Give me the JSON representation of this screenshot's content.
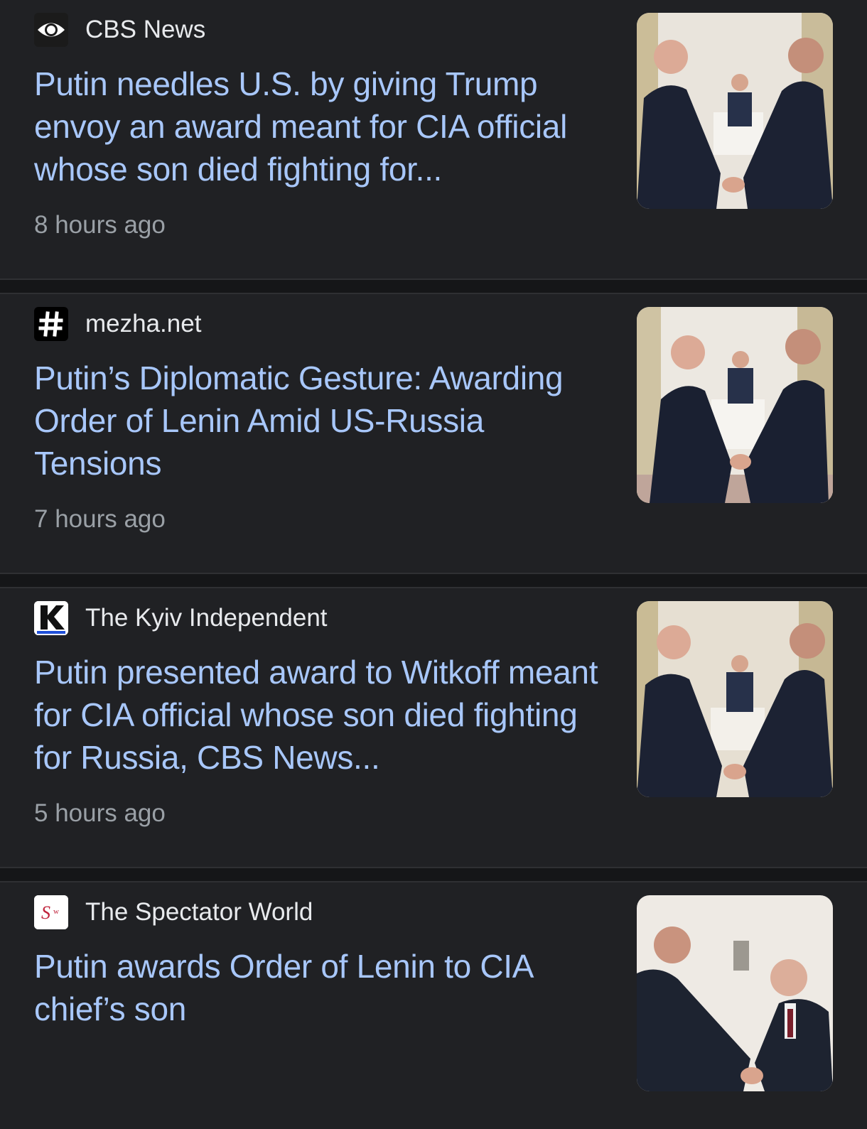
{
  "articles": [
    {
      "source": "CBS News",
      "source_icon": "cbs-eye-icon",
      "title": "Putin needles U.S. by giving Trump envoy an award meant for CIA official whose son died fighting for...",
      "time": "8 hours ago"
    },
    {
      "source": "mezha.net",
      "source_icon": "hash-icon",
      "title": "Putin’s Diplomatic Gesture: Awarding Order of Lenin Amid US-Russia Tensions",
      "time": "7 hours ago"
    },
    {
      "source": "The Kyiv Independent",
      "source_icon": "k-logo-icon",
      "title": "Putin presented award to Witkoff meant for CIA official whose son died fighting for Russia, CBS News...",
      "time": "5 hours ago"
    },
    {
      "source": "The Spectator World",
      "source_icon": "spectator-logo-icon",
      "title": "Putin awards Order of Lenin to CIA chief’s son",
      "time": ""
    }
  ],
  "colors": {
    "background": "#202124",
    "headline": "#a8c7fa",
    "source_text": "#e8eaed",
    "timestamp": "#9aa0a6",
    "separator": "#151618"
  }
}
